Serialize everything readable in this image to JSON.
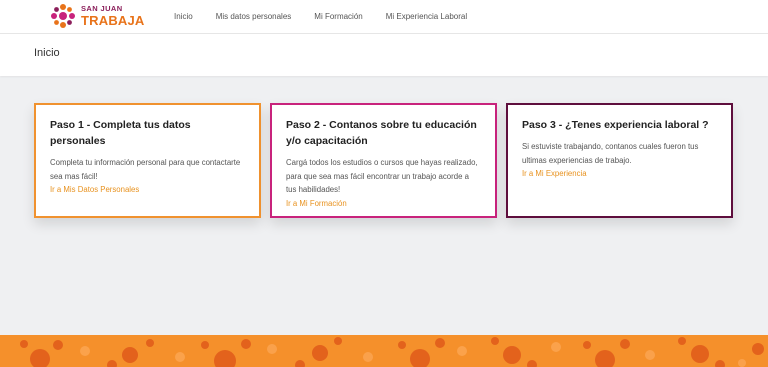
{
  "brand": {
    "line1": "SAN JUAN",
    "line2": "TRABAJA",
    "colors": {
      "orange": "#e8731a",
      "magenta": "#c8237c",
      "plum": "#5e0e3d"
    }
  },
  "nav": {
    "items": [
      {
        "label": "Inicio"
      },
      {
        "label": "Mis datos personales"
      },
      {
        "label": "Mi Formación"
      },
      {
        "label": "Mi Experiencia Laboral"
      }
    ]
  },
  "page": {
    "title": "Inicio"
  },
  "cards": [
    {
      "title": "Paso 1 - Completa tus datos personales",
      "text": "Completa tu información personal para que contactarte sea mas fácil!",
      "link": "Ir a Mis Datos Personales",
      "border_color": "#f0922f"
    },
    {
      "title": "Paso 2 - Contanos sobre tu educación y/o capacitación",
      "text": "Cargá todos los estudios o cursos que hayas realizado, para que sea mas fácil encontrar un trabajo acorde a tus habilidades!",
      "link": "Ir a Mi Formación",
      "border_color": "#c8237c"
    },
    {
      "title": "Paso 3 - ¿Tenes experiencia laboral ?",
      "text": "Si estuviste trabajando, contanos cuales fueron tus ultimas experiencias de trabajo.",
      "link": "Ir a Mi Experiencia",
      "border_color": "#5e0e3d"
    }
  ],
  "footer": {
    "pattern_color": "#f5902b",
    "pattern_accent": "#e05a1a"
  }
}
